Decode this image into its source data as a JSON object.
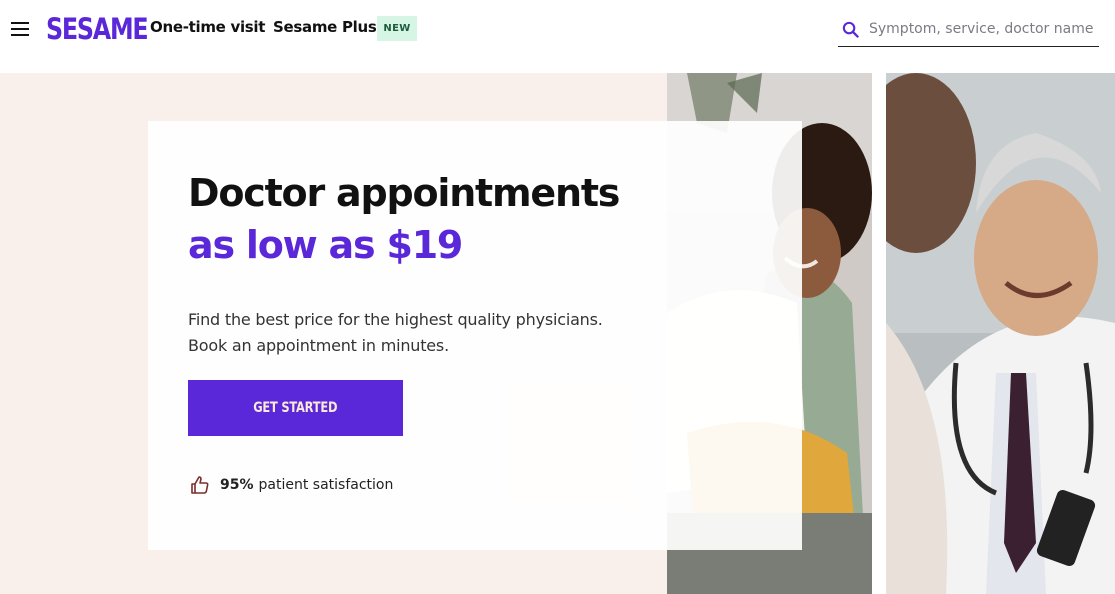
{
  "header": {
    "logo": "SESAME",
    "nav": {
      "one_time": "One-time visit",
      "plus": "Sesame Plus",
      "new_badge": "NEW"
    },
    "search": {
      "placeholder": "Symptom, service, doctor name",
      "value": ""
    },
    "icons": {
      "menu": "hamburger-menu-icon",
      "search": "search-icon"
    }
  },
  "hero": {
    "title_line1": "Doctor appointments",
    "title_line2": "as low as $19",
    "subtitle_line1": "Find the best price for the highest quality physicians.",
    "subtitle_line2": "Book an appointment in minutes.",
    "cta_label": "GET STARTED",
    "rating": {
      "value": "95%",
      "text": "patient satisfaction",
      "icon": "thumbs-up-icon"
    }
  },
  "colors": {
    "brand": "#5a28d8",
    "hero_bg": "#faf0eb",
    "badge_bg": "#d6f5e4",
    "cta_text": "#fde7d6"
  }
}
